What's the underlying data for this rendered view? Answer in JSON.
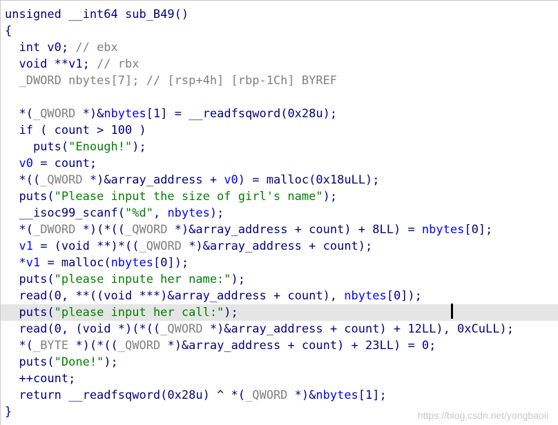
{
  "code_lines": [
    [
      {
        "t": "unsigned __int64 sub_B49()",
        "c": "code"
      }
    ],
    [
      {
        "t": "{",
        "c": "code"
      }
    ],
    [
      {
        "t": "  int v0; ",
        "c": "code"
      },
      {
        "t": "// ebx",
        "c": "comment"
      }
    ],
    [
      {
        "t": "  void **v1; ",
        "c": "code"
      },
      {
        "t": "// rbx",
        "c": "comment"
      }
    ],
    [
      {
        "t": "  _DWORD nbytes[7]; ",
        "c": "type"
      },
      {
        "t": "// [rsp+4h] [rbp-1Ch] BYREF",
        "c": "comment"
      }
    ],
    [],
    [
      {
        "t": "  *(",
        "c": "code"
      },
      {
        "t": "_QWORD",
        "c": "type"
      },
      {
        "t": " *)&",
        "c": "code"
      },
      {
        "t": "nbytes",
        "c": "var"
      },
      {
        "t": "[1] = __readfsqword(0x28u);",
        "c": "code"
      }
    ],
    [
      {
        "t": "  if ( count > 100 )",
        "c": "code"
      }
    ],
    [
      {
        "t": "    puts(",
        "c": "code"
      },
      {
        "t": "\"Enough!\"",
        "c": "str"
      },
      {
        "t": ");",
        "c": "code"
      }
    ],
    [
      {
        "t": "  ",
        "c": "code"
      },
      {
        "t": "v0",
        "c": "var"
      },
      {
        "t": " = count;",
        "c": "code"
      }
    ],
    [
      {
        "t": "  *((",
        "c": "code"
      },
      {
        "t": "_QWORD",
        "c": "type"
      },
      {
        "t": " *)&array_address + ",
        "c": "code"
      },
      {
        "t": "v0",
        "c": "var"
      },
      {
        "t": ") = malloc(0x18uLL);",
        "c": "code"
      }
    ],
    [
      {
        "t": "  puts(",
        "c": "code"
      },
      {
        "t": "\"Please input the size of girl's name\"",
        "c": "str"
      },
      {
        "t": ");",
        "c": "code"
      }
    ],
    [
      {
        "t": "  __isoc99_scanf(",
        "c": "code"
      },
      {
        "t": "\"%d\"",
        "c": "str"
      },
      {
        "t": ", ",
        "c": "code"
      },
      {
        "t": "nbytes",
        "c": "var"
      },
      {
        "t": ");",
        "c": "code"
      }
    ],
    [
      {
        "t": "  *(",
        "c": "code"
      },
      {
        "t": "_DWORD",
        "c": "type"
      },
      {
        "t": " *)(*((",
        "c": "code"
      },
      {
        "t": "_QWORD",
        "c": "type"
      },
      {
        "t": " *)&array_address + count) + 8LL) = ",
        "c": "code"
      },
      {
        "t": "nbytes",
        "c": "var"
      },
      {
        "t": "[0];",
        "c": "code"
      }
    ],
    [
      {
        "t": "  ",
        "c": "code"
      },
      {
        "t": "v1",
        "c": "var"
      },
      {
        "t": " = (void **)*((",
        "c": "code"
      },
      {
        "t": "_QWORD",
        "c": "type"
      },
      {
        "t": " *)&array_address + count);",
        "c": "code"
      }
    ],
    [
      {
        "t": "  *",
        "c": "code"
      },
      {
        "t": "v1",
        "c": "var"
      },
      {
        "t": " = malloc(",
        "c": "code"
      },
      {
        "t": "nbytes",
        "c": "var"
      },
      {
        "t": "[0]);",
        "c": "code"
      }
    ],
    [
      {
        "t": "  puts(",
        "c": "code"
      },
      {
        "t": "\"please inpute her name:\"",
        "c": "str"
      },
      {
        "t": ");",
        "c": "code"
      }
    ],
    [
      {
        "t": "  read(0, **((void ***)&array_address + count), ",
        "c": "code"
      },
      {
        "t": "nbytes",
        "c": "var"
      },
      {
        "t": "[0]);",
        "c": "code"
      }
    ],
    [
      {
        "t": "  puts(",
        "c": "code"
      },
      {
        "t": "\"please input her call:\"",
        "c": "str"
      },
      {
        "t": ");",
        "c": "code"
      }
    ],
    [
      {
        "t": "  read(0, (void *)(*((",
        "c": "code"
      },
      {
        "t": "_QWORD",
        "c": "type"
      },
      {
        "t": " *)&array_address + count) + 12LL), 0xCuLL);",
        "c": "code"
      }
    ],
    [
      {
        "t": "  *(",
        "c": "code"
      },
      {
        "t": "_BYTE",
        "c": "type"
      },
      {
        "t": " *)(*((",
        "c": "code"
      },
      {
        "t": "_QWORD",
        "c": "type"
      },
      {
        "t": " *)&array_address + count) + 23LL) = 0;",
        "c": "code"
      }
    ],
    [
      {
        "t": "  puts(",
        "c": "code"
      },
      {
        "t": "\"Done!\"",
        "c": "str"
      },
      {
        "t": ");",
        "c": "code"
      }
    ],
    [
      {
        "t": "  ++count;",
        "c": "code"
      }
    ],
    [
      {
        "t": "  return __readfsqword(0x28u) ^ *(",
        "c": "code"
      },
      {
        "t": "_QWORD",
        "c": "type"
      },
      {
        "t": " *)&",
        "c": "code"
      },
      {
        "t": "nbytes",
        "c": "var"
      },
      {
        "t": "[1];",
        "c": "code"
      }
    ],
    [
      {
        "t": "}",
        "c": "code"
      }
    ]
  ],
  "current_line": 18,
  "watermark": "https://blog.csdn.net/yongbaoii",
  "colors": {
    "code": "#000080",
    "comment": "#808080",
    "variable": "#0000ff",
    "string": "#008000",
    "type": "#808080",
    "highlight": "#e5e5e5"
  }
}
